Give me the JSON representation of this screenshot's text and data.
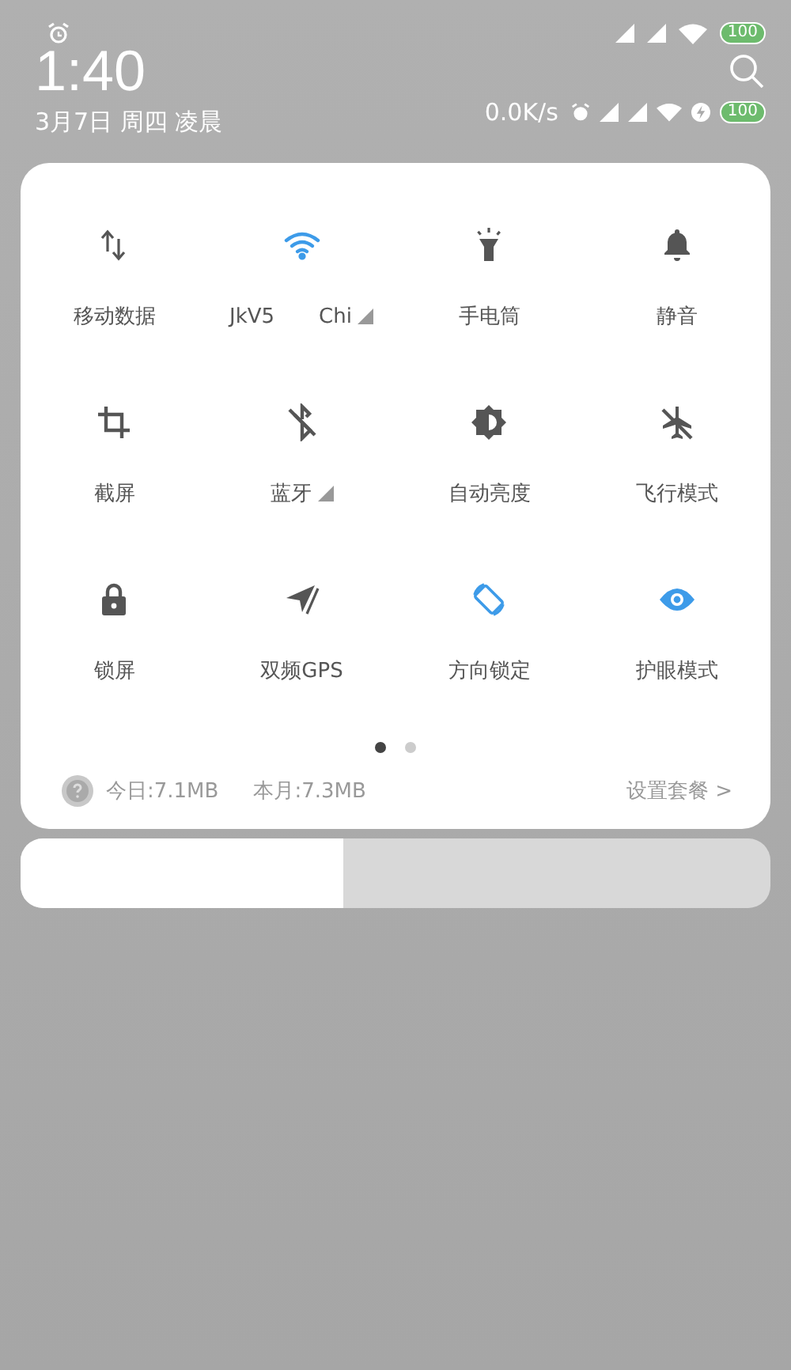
{
  "status_bar": {
    "time": "1:40",
    "date": "3月7日 周四 凌晨",
    "net_speed": "0.0K/s",
    "battery": "100",
    "battery_2": "100"
  },
  "tiles": [
    {
      "kind": "data",
      "label": "移动数据",
      "on": false,
      "has_menu": false
    },
    {
      "kind": "wifi",
      "label": "JkV5",
      "label_2": "Chi",
      "on": true,
      "has_menu": true
    },
    {
      "kind": "flashlight",
      "label": "手电筒",
      "on": false,
      "has_menu": false
    },
    {
      "kind": "bell",
      "label": "静音",
      "on": false,
      "has_menu": false
    },
    {
      "kind": "crop",
      "label": "截屏",
      "on": false,
      "has_menu": false
    },
    {
      "kind": "bluetooth",
      "label": "蓝牙",
      "on": false,
      "has_menu": true
    },
    {
      "kind": "brightness",
      "label": "自动亮度",
      "on": false,
      "has_menu": false
    },
    {
      "kind": "airplane",
      "label": "飞行模式",
      "on": false,
      "has_menu": false
    },
    {
      "kind": "lock",
      "label": "锁屏",
      "on": false,
      "has_menu": false
    },
    {
      "kind": "gps",
      "label": "双频GPS",
      "on": false,
      "has_menu": false
    },
    {
      "kind": "rotate",
      "label": "方向锁定",
      "on": true,
      "has_menu": false
    },
    {
      "kind": "eye",
      "label": "护眼模式",
      "on": true,
      "has_menu": false
    }
  ],
  "pages": [
    {
      "selected": true
    },
    {
      "selected": false
    }
  ],
  "usage": {
    "today": "今日:7.1MB",
    "month": "本月:7.3MB",
    "plan_link": "设置套餐 >"
  },
  "brightness": {
    "level": 0.43
  }
}
